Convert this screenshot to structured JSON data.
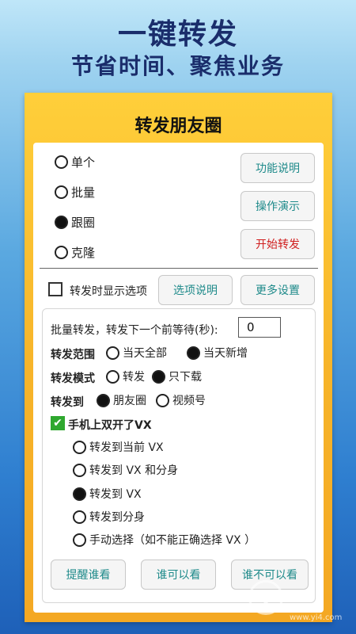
{
  "hero": {
    "title": "一键转发",
    "subtitle": "节省时间、聚焦业务"
  },
  "app": {
    "title": "转发朋友圈",
    "mode_options": [
      {
        "label": "单个",
        "selected": false
      },
      {
        "label": "批量",
        "selected": false
      },
      {
        "label": "跟圈",
        "selected": true
      },
      {
        "label": "克隆",
        "selected": false
      }
    ],
    "buttons": {
      "help": "功能说明",
      "demo": "操作演示",
      "start": "开始转发"
    },
    "show_options": {
      "label": "转发时显示选项",
      "checked": false
    },
    "option_help": "选项说明",
    "more_settings": "更多设置",
    "batch_wait_label": "批量转发，转发下一个前等待(秒):",
    "batch_wait_value": "0",
    "range": {
      "label": "转发范围",
      "options": [
        {
          "label": "当天全部",
          "selected": false
        },
        {
          "label": "当天新增",
          "selected": true
        }
      ]
    },
    "mode": {
      "label": "转发模式",
      "options": [
        {
          "label": "转发",
          "selected": false
        },
        {
          "label": "只下载",
          "selected": true
        }
      ]
    },
    "target": {
      "label": "转发到",
      "options": [
        {
          "label": "朋友圈",
          "selected": true
        },
        {
          "label": "视频号",
          "selected": false
        }
      ]
    },
    "dual_vx": {
      "label": "手机上双开了VX",
      "checked": true
    },
    "dual_options": [
      {
        "label": "转发到当前 VX",
        "selected": false
      },
      {
        "label": "转发到 VX 和分身",
        "selected": false
      },
      {
        "label": "转发到 VX",
        "selected": true
      },
      {
        "label": "转发到分身",
        "selected": false
      },
      {
        "label": "手动选择（如不能正确选择 VX ）",
        "selected": false
      }
    ],
    "footer_buttons": {
      "remind": "提醒谁看",
      "visible": "谁可以看",
      "invisible": "谁不可以看"
    }
  },
  "watermark": {
    "url": "www.yi4.com"
  }
}
